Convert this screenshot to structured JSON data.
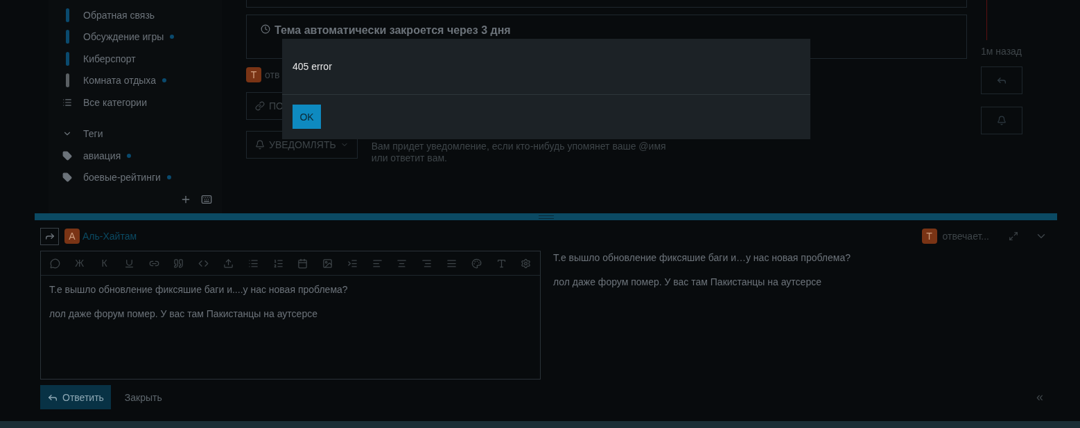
{
  "sidebar": {
    "categories": [
      {
        "name": "Обратная связь",
        "color": "#0a4a6e",
        "unread": false
      },
      {
        "name": "Обсуждение игры",
        "color": "#0a4a6e",
        "unread": true
      },
      {
        "name": "Киберспорт",
        "color": "#0a4a6e",
        "unread": false
      },
      {
        "name": "Комната отдыха",
        "color": "#5a5f63",
        "unread": true
      }
    ],
    "all_categories": "Все категории",
    "tags_heading": "Теги",
    "tags_expanded": true,
    "tags": [
      {
        "name": "авиация",
        "unread": true
      },
      {
        "name": "боевые-рейтинги",
        "unread": true
      }
    ]
  },
  "topic": {
    "auto_close_notice": "Тема автоматически закроется через 3 дня",
    "reply_avatar": "T",
    "reply_text": "отв",
    "share_button": "ПО",
    "notify_button": "УВЕДОМЛЯТЬ",
    "notify_description": "Вам придет уведомление, если кто-нибудь упомянет ваше @имя или ответит вам."
  },
  "timeline": {
    "time": "1м назад"
  },
  "modal": {
    "message": "405 error",
    "ok_button": "OK"
  },
  "composer": {
    "author_avatar": "A",
    "author": "Аль-Хайтам",
    "typing_avatar": "T",
    "typing_text": "отвечает...",
    "toolbar": [
      {
        "kind": "icon"
      },
      {
        "kind": "text",
        "label": "Ж"
      },
      {
        "kind": "text",
        "label": "К"
      },
      {
        "kind": "icon"
      },
      {
        "kind": "icon"
      },
      {
        "kind": "icon"
      },
      {
        "kind": "icon"
      },
      {
        "kind": "icon"
      },
      {
        "kind": "icon"
      },
      {
        "kind": "icon"
      },
      {
        "kind": "icon"
      },
      {
        "kind": "icon"
      },
      {
        "kind": "icon"
      },
      {
        "kind": "icon"
      },
      {
        "kind": "icon"
      },
      {
        "kind": "icon"
      },
      {
        "kind": "icon"
      },
      {
        "kind": "icon"
      },
      {
        "kind": "icon"
      },
      {
        "kind": "icon"
      }
    ],
    "editor_paragraphs": [
      "Т.е вышло обновление фиксяшие баги и....у нас новая проблема?",
      "лол даже форум помер. У вас там Пакистанцы на аутсерсе"
    ],
    "preview_paragraphs": [
      "Т.е вышло обновление фиксяшие баги и…у нас новая проблема?",
      "лол даже форум помер. У вас там Пакистанцы на аутсерсе"
    ],
    "reply_button": "Ответить",
    "close_button": "Закрыть",
    "collapse_glyph": "«"
  }
}
